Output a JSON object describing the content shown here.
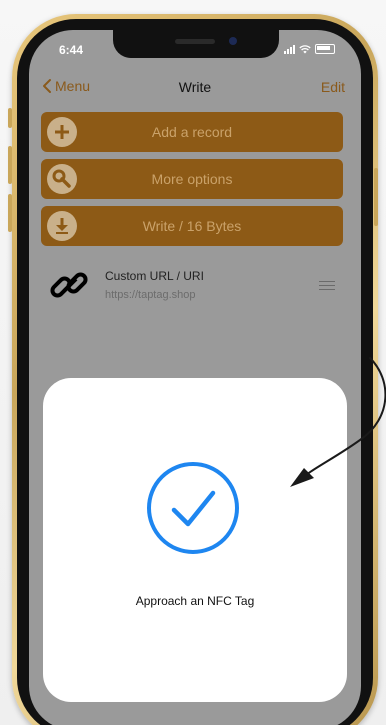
{
  "status": {
    "time": "6:44"
  },
  "nav": {
    "back_label": "Menu",
    "title": "Write",
    "edit_label": "Edit"
  },
  "actions": [
    {
      "label": "Add a record",
      "icon": "plus-circle-icon"
    },
    {
      "label": "More options",
      "icon": "wrench-icon"
    },
    {
      "label": "Write / 16 Bytes",
      "icon": "download-icon"
    }
  ],
  "record": {
    "icon": "link-icon",
    "title": "Custom URL / URI",
    "url": "https://taptag.shop",
    "handle": "reorder-icon"
  },
  "sheet": {
    "message": "Approach an NFC Tag",
    "icon": "checkmark-circle-icon",
    "accent_color": "#1e86f0"
  },
  "colors": {
    "button": "#8d5a16",
    "button_text": "#caa26a",
    "overlay": "#9a9a9a"
  }
}
